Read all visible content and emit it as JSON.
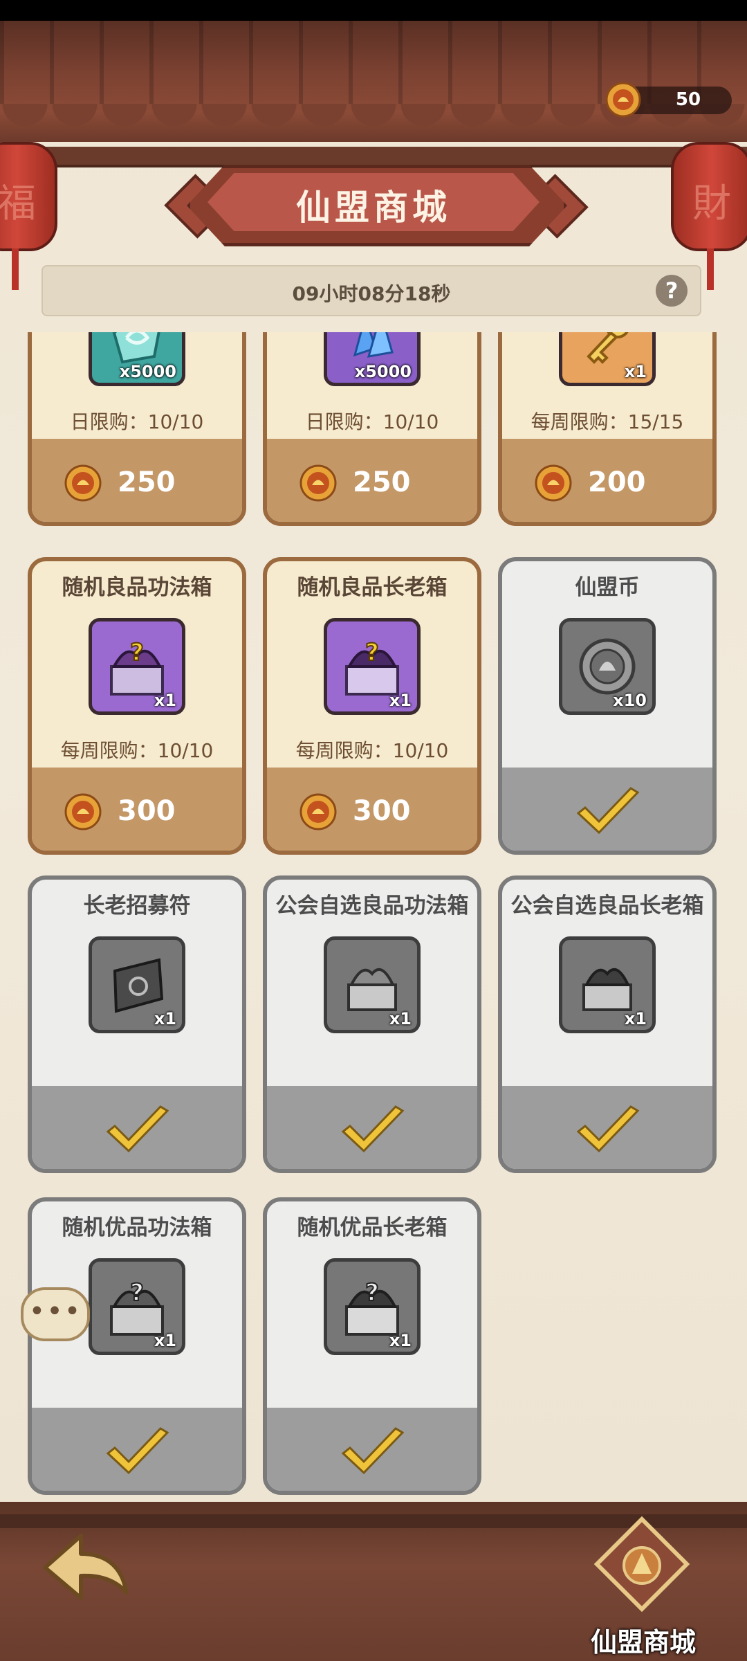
{
  "header": {
    "title": "仙盟商城",
    "currency_amount": "50",
    "timer_text": "09小时08分18秒",
    "help_label": "?"
  },
  "colors": {
    "roof": "#7d4232",
    "plaque": "#b8574a",
    "card_available": "#f6ebcf",
    "card_sold": "#ededec",
    "check": "#f0c43a",
    "coin": "#e7a238"
  },
  "shop": {
    "items": [
      {
        "name": "",
        "icon": "jade-icon",
        "qty": "x5000",
        "limit": "日限购：10/10",
        "price": "250",
        "sold_out": false
      },
      {
        "name": "",
        "icon": "crystal-icon",
        "qty": "x5000",
        "limit": "日限购：10/10",
        "price": "250",
        "sold_out": false
      },
      {
        "name": "",
        "icon": "golden-key-icon",
        "qty": "x1",
        "limit": "每周限购：15/15",
        "price": "200",
        "sold_out": false
      },
      {
        "name": "随机良品功法箱",
        "icon": "mystery-chest-icon",
        "qty": "x1",
        "limit": "每周限购：10/10",
        "price": "300",
        "sold_out": false
      },
      {
        "name": "随机良品长老箱",
        "icon": "mystery-chest-icon",
        "qty": "x1",
        "limit": "每周限购：10/10",
        "price": "300",
        "sold_out": false
      },
      {
        "name": "仙盟币",
        "icon": "guild-coin-icon",
        "qty": "x10",
        "limit": "",
        "price": "",
        "sold_out": true
      },
      {
        "name": "长老招募符",
        "icon": "talisman-icon",
        "qty": "x1",
        "limit": "",
        "price": "",
        "sold_out": true
      },
      {
        "name": "公会自选良品功法箱",
        "icon": "chest-icon",
        "qty": "x1",
        "limit": "",
        "price": "",
        "sold_out": true
      },
      {
        "name": "公会自选良品长老箱",
        "icon": "chest-icon",
        "qty": "x1",
        "limit": "",
        "price": "",
        "sold_out": true
      },
      {
        "name": "随机优品功法箱",
        "icon": "mystery-chest-icon",
        "qty": "x1",
        "limit": "",
        "price": "",
        "sold_out": true
      },
      {
        "name": "随机优品长老箱",
        "icon": "mystery-chest-icon",
        "qty": "x1",
        "limit": "",
        "price": "",
        "sold_out": true
      }
    ]
  },
  "chat": {
    "dots": "•••"
  },
  "footer": {
    "back_icon": "back-arrow-icon",
    "shop_tab_label": "仙盟商城",
    "lantern_left_glyph": "福",
    "lantern_right_glyph": "財"
  }
}
